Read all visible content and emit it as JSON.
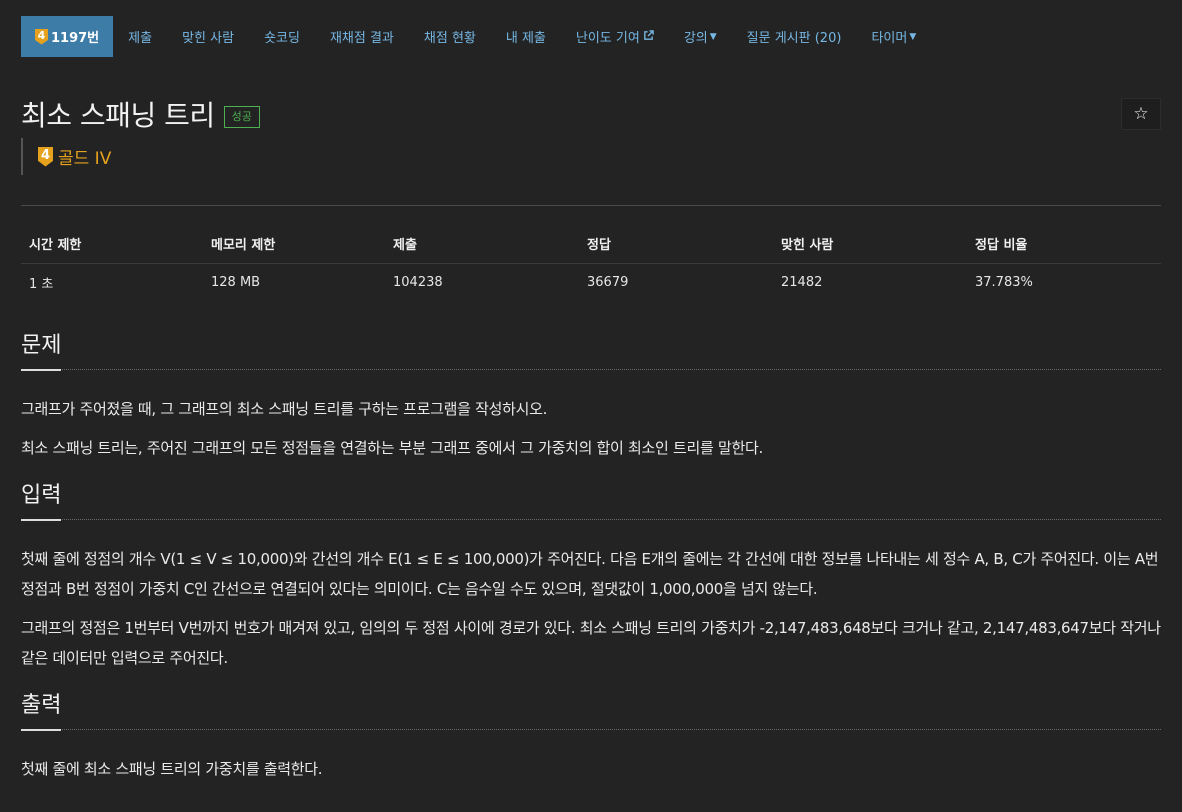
{
  "nav": {
    "problem_tier": "4",
    "problem_number": "1197번",
    "items": [
      "제출",
      "맞힌 사람",
      "숏코딩",
      "재채점 결과",
      "채점 현황",
      "내 제출",
      "난이도 기여",
      "강의",
      "질문 게시판 (20)",
      "타이머"
    ]
  },
  "problem": {
    "title": "최소 스패닝 트리",
    "result_badge": "성공",
    "tier_num": "4",
    "tier_label": "골드 IV",
    "star": "☆"
  },
  "info": {
    "headers": [
      "시간 제한",
      "메모리 제한",
      "제출",
      "정답",
      "맞힌 사람",
      "정답 비율"
    ],
    "values": [
      "1 초",
      "128 MB",
      "104238",
      "36679",
      "21482",
      "37.783%"
    ]
  },
  "sections": {
    "problem": {
      "heading": "문제",
      "paragraphs": [
        "그래프가 주어졌을 때, 그 그래프의 최소 스패닝 트리를 구하는 프로그램을 작성하시오.",
        "최소 스패닝 트리는, 주어진 그래프의 모든 정점들을 연결하는 부분 그래프 중에서 그 가중치의 합이 최소인 트리를 말한다."
      ]
    },
    "input": {
      "heading": "입력",
      "paragraphs": [
        "첫째 줄에 정점의 개수 V(1 ≤ V ≤ 10,000)와 간선의 개수 E(1 ≤ E ≤ 100,000)가 주어진다. 다음 E개의 줄에는 각 간선에 대한 정보를 나타내는 세 정수 A, B, C가 주어진다. 이는 A번 정점과 B번 정점이 가중치 C인 간선으로 연결되어 있다는 의미이다. C는 음수일 수도 있으며, 절댓값이 1,000,000을 넘지 않는다.",
        "그래프의 정점은 1번부터 V번까지 번호가 매겨져 있고, 임의의 두 정점 사이에 경로가 있다. 최소 스패닝 트리의 가중치가 -2,147,483,648보다 크거나 같고, 2,147,483,647보다 작거나 같은 데이터만 입력으로 주어진다."
      ]
    },
    "output": {
      "heading": "출력",
      "paragraphs": [
        "첫째 줄에 최소 스패닝 트리의 가중치를 출력한다."
      ]
    }
  },
  "colors": {
    "background": "#232323",
    "nav_link": "#76b7e3",
    "nav_active_bg": "#3e7ca8",
    "tier_gold": "#e6a21d",
    "success": "#4caf50"
  }
}
